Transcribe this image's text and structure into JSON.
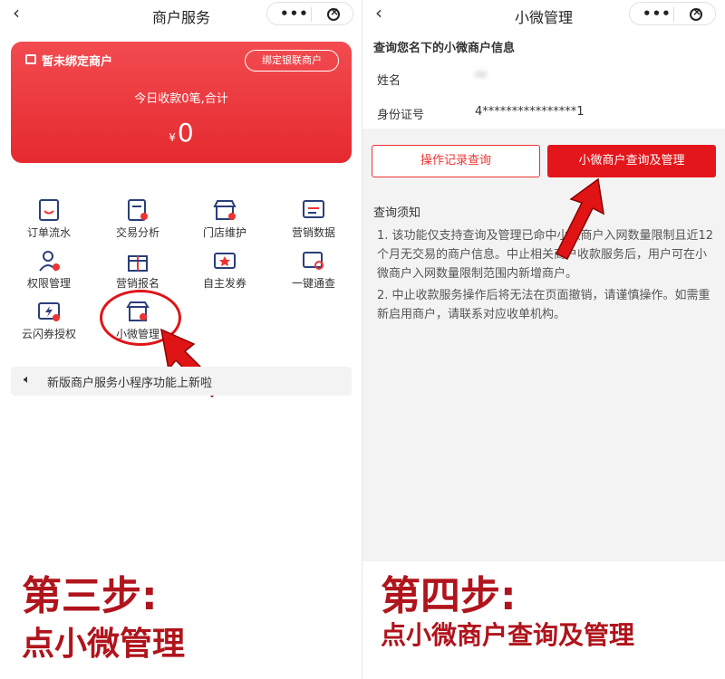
{
  "left": {
    "nav": {
      "title": "商户服务"
    },
    "card": {
      "status": "暂未绑定商户",
      "bind_button": "绑定银联商户",
      "today_summary": "今日收款0笔,合计",
      "currency": "¥",
      "amount": "0"
    },
    "functions": [
      {
        "label": "订单流水",
        "icon": "order-list-icon"
      },
      {
        "label": "交易分析",
        "icon": "trade-analysis-icon"
      },
      {
        "label": "门店维护",
        "icon": "store-icon"
      },
      {
        "label": "营销数据",
        "icon": "marketing-data-icon"
      },
      {
        "label": "权限管理",
        "icon": "user-permission-icon"
      },
      {
        "label": "营销报名",
        "icon": "gift-box-icon"
      },
      {
        "label": "自主发券",
        "icon": "coupon-star-icon"
      },
      {
        "label": "一键通查",
        "icon": "search-card-icon"
      },
      {
        "label": "云闪券授权",
        "icon": "lightning-coupon-icon"
      },
      {
        "label": "小微管理",
        "icon": "small-merchant-icon"
      }
    ],
    "notice": "新版商户服务小程序功能上新啦",
    "step_line1": "第三步:",
    "step_line2": "点小微管理"
  },
  "right": {
    "nav": {
      "title": "小微管理"
    },
    "heading": "查询您名下的小微商户信息",
    "name_label": "姓名",
    "name_value": "**",
    "id_label": "身份证号",
    "id_value": "4****************1",
    "btn_records": "操作记录查询",
    "btn_manage": "小微商户查询及管理",
    "notes_title": "查询须知",
    "note1": "1. 该功能仅支持查询及管理已命中小微商户入网数量限制且近12个月无交易的商户信息。中止相关商户收款服务后，用户可在小微商户入网数量限制范围内新增商户。",
    "note2": "2. 中止收款服务操作后将无法在页面撤销，请谨慎操作。如需重新启用商户，请联系对应收单机构。",
    "step_line1": "第四步:",
    "step_line2": "点小微商户查询及管理"
  },
  "colors": {
    "brand_red": "#e3161b",
    "step_text": "#b0141c"
  }
}
